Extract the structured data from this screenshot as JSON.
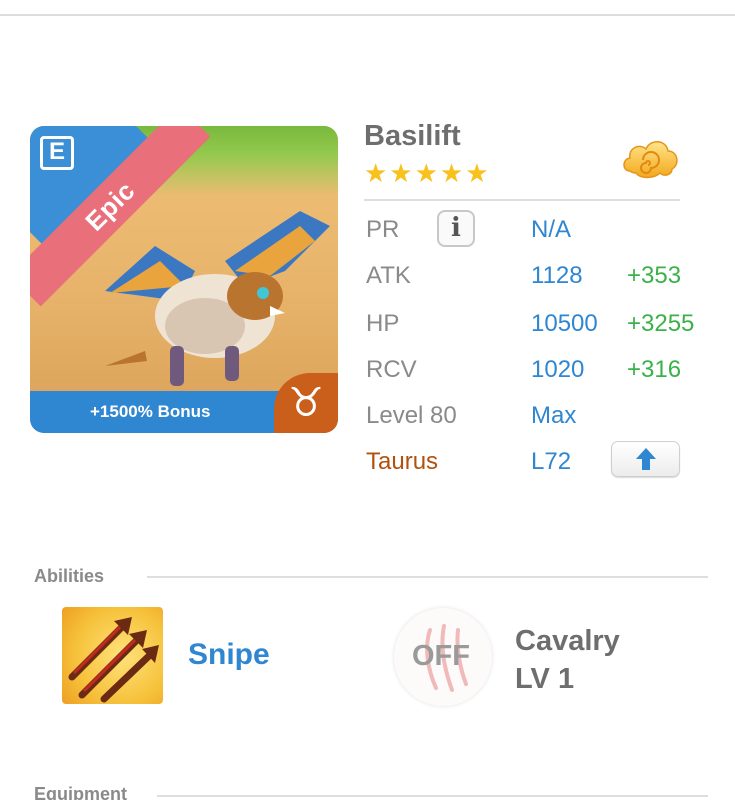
{
  "monster": {
    "name": "Basilift",
    "rarity": "Epic",
    "stars": "★★★★★",
    "bonus": "+1500% Bonus",
    "card_icon_letter": "E",
    "zodiac_symbol": "♉"
  },
  "stats": {
    "pr_label": "PR",
    "pr_value": "N/A",
    "info_glyph": "i",
    "atk_label": "ATK",
    "atk_value": "1128",
    "atk_bonus": "+353",
    "hp_label": "HP",
    "hp_value": "10500",
    "hp_bonus": "+3255",
    "rcv_label": "RCV",
    "rcv_value": "1020",
    "rcv_bonus": "+316",
    "level_label": "Level 80",
    "level_value": "Max",
    "zodiac_label": "Taurus",
    "zodiac_level": "L72"
  },
  "abilities": {
    "title": "Abilities",
    "skill_name": "Snipe",
    "leader_status": "OFF",
    "leader_name_line1": "Cavalry",
    "leader_name_line2": "LV 1"
  },
  "equipment": {
    "title": "Equipment"
  },
  "colors": {
    "accent_blue": "#2f86d1",
    "bonus_green": "#3bb14a",
    "taurus_brown": "#b0520e",
    "star_gold": "#f8c11b",
    "epic_ribbon": "#e9707a"
  },
  "icons": {
    "card_type": "element-e-icon",
    "zodiac": "taurus-icon",
    "evolve": "cloud-spiral-icon",
    "info": "info-icon",
    "upgrade": "arrow-up-icon",
    "skill": "triple-arrow-icon",
    "leader_skill": "claw-scratch-icon"
  }
}
